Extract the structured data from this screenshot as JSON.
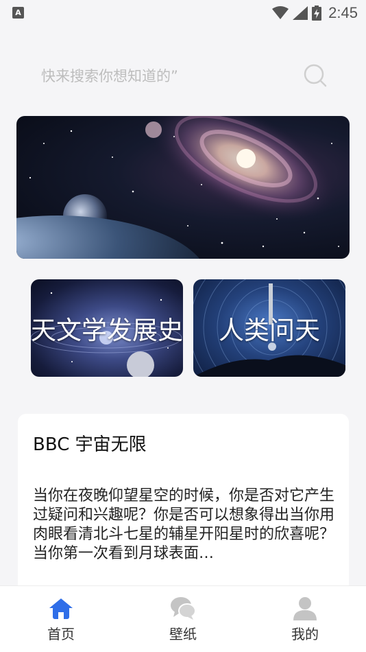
{
  "status_bar": {
    "notification_badge": "A",
    "time": "2:45",
    "icons": [
      "wifi-icon",
      "signal-icon",
      "battery-charging-icon"
    ]
  },
  "search": {
    "placeholder": "快来搜索你想知道的”",
    "icon": "search-icon"
  },
  "banner": {
    "image": "galaxy-banner-image"
  },
  "categories": [
    {
      "label": "天文学发展史",
      "image": "solar-system-image"
    },
    {
      "label": "人类问天",
      "image": "rocket-launch-image"
    }
  ],
  "article": {
    "title": "BBC 宇宙无限",
    "body": "当你在夜晚仰望星空的时候，你是否对它产生过疑问和兴趣呢？你是否可以想象得出当你用肉眼看清北斗七星的辅星开阳星时的欣喜呢？当你第一次看到月球表面…"
  },
  "bottom_nav": {
    "items": [
      {
        "label": "首页",
        "icon": "home-icon",
        "active": true
      },
      {
        "label": "壁纸",
        "icon": "chat-icon",
        "active": false
      },
      {
        "label": "我的",
        "icon": "user-icon",
        "active": false
      }
    ]
  },
  "colors": {
    "background": "#f5f5f7",
    "accent": "#2f6ee8",
    "inactive_icon": "#bdbdbd",
    "placeholder_text": "#bdbdbd"
  }
}
